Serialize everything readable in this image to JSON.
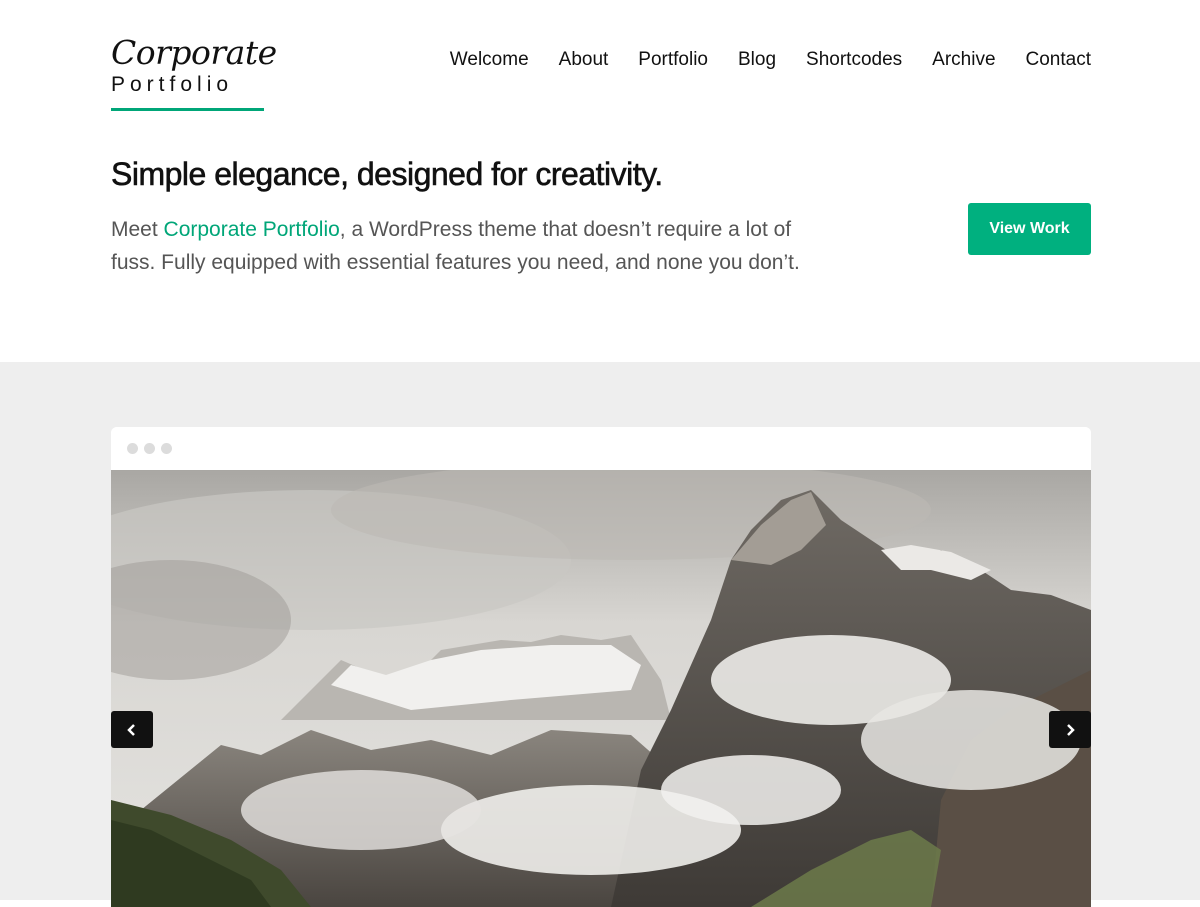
{
  "logo": {
    "script": "Corporate",
    "sub": "Portfolio"
  },
  "nav": [
    "Welcome",
    "About",
    "Portfolio",
    "Blog",
    "Shortcodes",
    "Archive",
    "Contact"
  ],
  "hero": {
    "title": "Simple elegance, designed for creativity.",
    "text_before": "Meet ",
    "text_brand": "Corporate Portfolio",
    "text_after": ", a WordPress theme that doesn’t require a lot of fuss. Fully equipped with essential features you need, and none you don’t.",
    "button": "View Work"
  },
  "slider": {
    "image": "mountain-landscape-with-clouds",
    "prev_icon": "chevron-left-icon",
    "next_icon": "chevron-right-icon"
  },
  "colors": {
    "accent": "#00a678",
    "button": "#00b07f",
    "background_band": "#eeeeee"
  }
}
